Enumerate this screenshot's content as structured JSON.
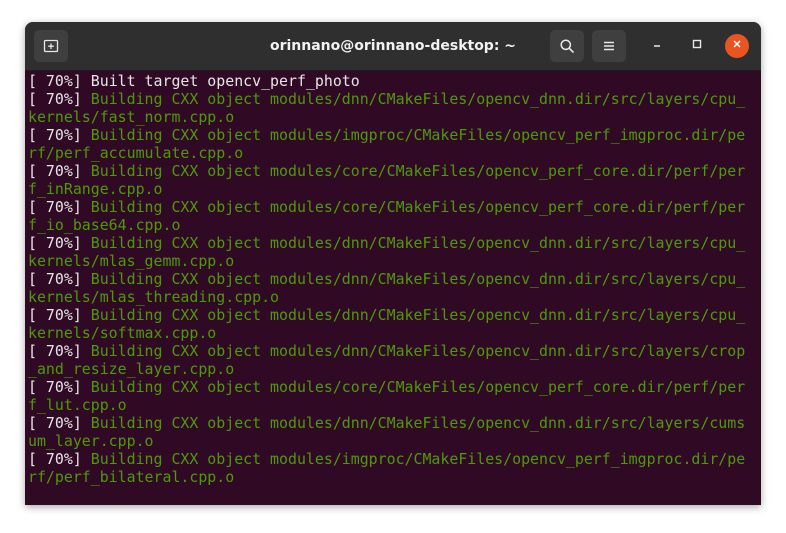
{
  "window": {
    "title": "orinnano@orinnano-desktop: ~"
  },
  "header_icons": {
    "new_tab": "new-tab-icon",
    "search": "search-icon",
    "menu": "hamburger-menu-icon",
    "minimize": "minimize-icon",
    "maximize": "maximize-icon",
    "close": "close-icon"
  },
  "colors": {
    "terminal_bg": "#300a24",
    "titlebar_bg": "#2f2f2f",
    "build_text": "#4e9a06",
    "plain_text": "#e6e6e6",
    "close_button": "#e95420"
  },
  "terminal": {
    "lines": [
      {
        "pct": "[ 70%]",
        "text": " Built target opencv_perf_photo",
        "style": "plain"
      },
      {
        "pct": "[ 70%]",
        "text": " Building CXX object modules/dnn/CMakeFiles/opencv_dnn.dir/src/layers/cpu_",
        "style": "green"
      },
      {
        "pct": "",
        "text": "kernels/fast_norm.cpp.o",
        "style": "green"
      },
      {
        "pct": "[ 70%]",
        "text": " Building CXX object modules/imgproc/CMakeFiles/opencv_perf_imgproc.dir/pe",
        "style": "green"
      },
      {
        "pct": "",
        "text": "rf/perf_accumulate.cpp.o",
        "style": "green"
      },
      {
        "pct": "[ 70%]",
        "text": " Building CXX object modules/core/CMakeFiles/opencv_perf_core.dir/perf/per",
        "style": "green"
      },
      {
        "pct": "",
        "text": "f_inRange.cpp.o",
        "style": "green"
      },
      {
        "pct": "[ 70%]",
        "text": " Building CXX object modules/core/CMakeFiles/opencv_perf_core.dir/perf/per",
        "style": "green"
      },
      {
        "pct": "",
        "text": "f_io_base64.cpp.o",
        "style": "green"
      },
      {
        "pct": "[ 70%]",
        "text": " Building CXX object modules/dnn/CMakeFiles/opencv_dnn.dir/src/layers/cpu_",
        "style": "green"
      },
      {
        "pct": "",
        "text": "kernels/mlas_gemm.cpp.o",
        "style": "green"
      },
      {
        "pct": "[ 70%]",
        "text": " Building CXX object modules/dnn/CMakeFiles/opencv_dnn.dir/src/layers/cpu_",
        "style": "green"
      },
      {
        "pct": "",
        "text": "kernels/mlas_threading.cpp.o",
        "style": "green"
      },
      {
        "pct": "[ 70%]",
        "text": " Building CXX object modules/dnn/CMakeFiles/opencv_dnn.dir/src/layers/cpu_",
        "style": "green"
      },
      {
        "pct": "",
        "text": "kernels/softmax.cpp.o",
        "style": "green"
      },
      {
        "pct": "[ 70%]",
        "text": " Building CXX object modules/dnn/CMakeFiles/opencv_dnn.dir/src/layers/crop",
        "style": "green"
      },
      {
        "pct": "",
        "text": "_and_resize_layer.cpp.o",
        "style": "green"
      },
      {
        "pct": "[ 70%]",
        "text": " Building CXX object modules/core/CMakeFiles/opencv_perf_core.dir/perf/per",
        "style": "green"
      },
      {
        "pct": "",
        "text": "f_lut.cpp.o",
        "style": "green"
      },
      {
        "pct": "[ 70%]",
        "text": " Building CXX object modules/dnn/CMakeFiles/opencv_dnn.dir/src/layers/cums",
        "style": "green"
      },
      {
        "pct": "",
        "text": "um_layer.cpp.o",
        "style": "green"
      },
      {
        "pct": "[ 70%]",
        "text": " Building CXX object modules/imgproc/CMakeFiles/opencv_perf_imgproc.dir/pe",
        "style": "green"
      },
      {
        "pct": "",
        "text": "rf/perf_bilateral.cpp.o",
        "style": "green"
      }
    ]
  }
}
